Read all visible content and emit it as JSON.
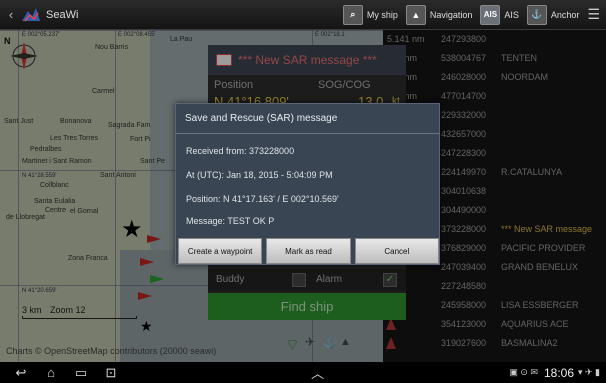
{
  "app": {
    "name": "SeaWi"
  },
  "toolbar": {
    "my_ship": "My ship",
    "navigation": "Navigation",
    "ais_badge": "AIS",
    "ais": "AIS",
    "anchor": "Anchor"
  },
  "map": {
    "compass_n": "N",
    "coord_labels": [
      "E 002°05.237'",
      "E 002°08.455'",
      "E 002°18.1",
      "N 41°28.559'",
      "N 41°20.659'"
    ],
    "place_labels": [
      "Nou Barris",
      "La Pau",
      "Carmel",
      "Bonanova",
      "Sagrada Fam",
      "Les Tres Torres",
      "Pedralbes",
      "Fort Pi",
      "Martinet i Sant Ramon",
      "Sant Antoni",
      "Sant Pe",
      "Collblanc",
      "Santa Eulalia",
      "Centre",
      "el Gornal",
      "de Llobregat",
      "Zona Franca",
      "Sant Just"
    ],
    "scale_text": "3 km",
    "zoom_text": "Zoom 12",
    "credits": "Charts © OpenStreetMap contributors  (20000 seawi)"
  },
  "sar_panel": {
    "title": "*** New SAR message ***",
    "position_label": "Position",
    "sogcog_label": "SOG/COG",
    "position_value": "N 41°16.809'",
    "speed_value": "13.0",
    "speed_unit": "kt",
    "buddy_label": "Buddy",
    "alarm_label": "Alarm",
    "find_ship": "Find ship"
  },
  "ais_list": [
    {
      "mmsi": "247293800",
      "name": "",
      "distance": "5.141 nm"
    },
    {
      "mmsi": "538004767",
      "name": "TENTEN",
      "distance": "372 nm"
    },
    {
      "mmsi": "246028000",
      "name": "NOORDAM",
      "distance": "542 nm"
    },
    {
      "mmsi": "477014700",
      "name": "",
      "distance": "125 nm"
    },
    {
      "mmsi": "229332000",
      "name": "",
      "distance": ""
    },
    {
      "mmsi": "432657000",
      "name": "",
      "distance": ""
    },
    {
      "mmsi": "247228300",
      "name": "",
      "distance": ""
    },
    {
      "mmsi": "224149970",
      "name": "R.CATALUNYA",
      "distance": ""
    },
    {
      "mmsi": "304010638",
      "name": "",
      "distance": ""
    },
    {
      "mmsi": "304490000",
      "name": "",
      "distance": ""
    },
    {
      "mmsi": "373228000",
      "name": "*** New SAR message",
      "distance": ""
    },
    {
      "mmsi": "376829000",
      "name": "PACIFIC PROVIDER",
      "distance": ""
    },
    {
      "mmsi": "247039400",
      "name": "GRAND BENELUX",
      "distance": ""
    },
    {
      "mmsi": "227248580",
      "name": "",
      "distance": ""
    },
    {
      "mmsi": "245958000",
      "name": "LISA ESSBERGER",
      "distance": ""
    },
    {
      "mmsi": "354123000",
      "name": "AQUARIUS ACE",
      "distance": ""
    },
    {
      "mmsi": "319027600",
      "name": "BASMALINA2",
      "distance": ""
    }
  ],
  "dialog": {
    "title": "Save and Rescue (SAR) message",
    "received_from": "Received from: 373228000",
    "time": "At (UTC): Jan 18, 2015 - 5:04:09 PM",
    "position": "Position: N 41°17.163' / E 002°10.569'",
    "message": "Message: TEST OK P",
    "btn_waypoint": "Create a waypoint",
    "btn_read": "Mark as read",
    "btn_cancel": "Cancel"
  },
  "system_bar": {
    "clock": "18:06"
  },
  "colors": {
    "sar_red": "#e06d6d",
    "sar_yellow": "#e7c847",
    "find_ship_green": "#2d8f2d",
    "dialog_bg": "#394553"
  }
}
